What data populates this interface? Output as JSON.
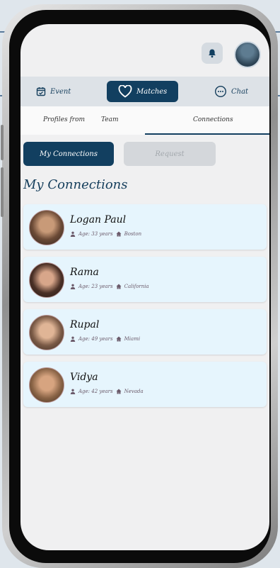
{
  "nav": {
    "event_label": "Event",
    "matches_label": "Matches",
    "chat_label": "Chat"
  },
  "subtabs": {
    "profiles_label": "Profiles from",
    "team_label": "Team",
    "connections_label": "Connections"
  },
  "buttons": {
    "my_connections": "My Connections",
    "request": "Request"
  },
  "section_title": "My Connections",
  "connections": [
    {
      "name": "Logan Paul",
      "age": "Age: 33 years",
      "location": "Boston",
      "avatar_color": "#6b4a36"
    },
    {
      "name": "Rama",
      "age": "Age: 23 years",
      "location": "California",
      "avatar_color": "#4a3026"
    },
    {
      "name": "Rupal",
      "age": "Age: 49 years",
      "location": "Miami",
      "avatar_color": "#7a5a46"
    },
    {
      "name": "Vidya",
      "age": "Age: 42 years",
      "location": "Nevada",
      "avatar_color": "#8a6446"
    }
  ],
  "colors": {
    "primary": "#123f60",
    "card_bg": "#e6f5fd",
    "nav_bg": "#dde2e7"
  }
}
